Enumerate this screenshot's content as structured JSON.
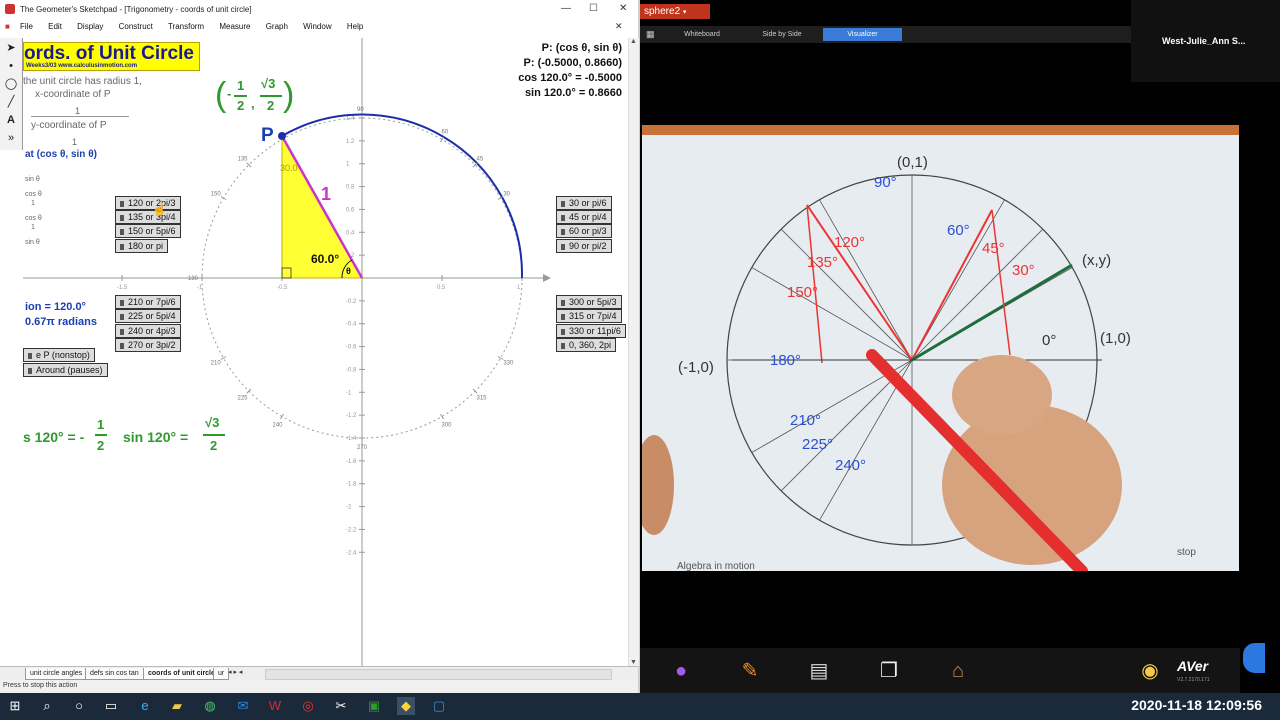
{
  "gsp": {
    "title": "The Geometer's Sketchpad - [Trigonometry - coords of unit circle]",
    "menu": [
      "File",
      "Edit",
      "Display",
      "Construct",
      "Transform",
      "Measure",
      "Graph",
      "Window",
      "Help"
    ],
    "heading": "ords. of Unit Circle",
    "subheading": "Weeks3/03  www.calculusinmotion.com",
    "notes": [
      "the unit circle has radius 1,",
      "x-coordinate of P",
      "1",
      "y-coordinate of P",
      "1"
    ],
    "at_text": "at (cos θ, sin θ)",
    "small_labels": [
      "sin θ",
      "cos θ",
      "1",
      "cos θ",
      "1",
      "sin θ"
    ],
    "rotation_line1": "ion = 120.0°",
    "rotation_line2": "0.67π radians",
    "btn_nonstop": "e P (nonstop)",
    "btn_around": "Around (pauses)",
    "left_buttons": [
      "120 or 2pi/3",
      "135 or 3pi/4",
      "150 or 5pi/6",
      "180 or pi"
    ],
    "left_buttons2": [
      "210 or 7pi/6",
      "225 or 5pi/4",
      "240 or 4pi/3",
      "270 or 3pi/2"
    ],
    "right_buttons": [
      "30 or pi/6",
      "45 or pi/4",
      "60 or pi/3",
      "90 or pi/2"
    ],
    "right_buttons2": [
      "300 or 5pi/3",
      "315 or 7pi/4",
      "330 or 11pi/6",
      "0, 360, 2pi"
    ],
    "info": [
      "P: (cos θ, sin θ)",
      "P: (-0.5000, 0.8660)",
      "cos 120.0° = -0.5000",
      "sin 120.0° = 0.8660"
    ],
    "point_label": "P",
    "hyp_label": "1",
    "angle_label": "60.0°",
    "theta": "θ",
    "angle30": "30.0",
    "coord_label": {
      "x_num": "1",
      "x_den": "2",
      "y_num": "√3",
      "y_den": "2",
      "neg": "-"
    },
    "bottom": {
      "cos_prefix": "s 120° = -",
      "cos_num": "1",
      "cos_den": "2",
      "sin_prefix": "sin 120° =",
      "sin_num": "√3",
      "sin_den": "2"
    },
    "axis_x_ticks": [
      "-1.5",
      "-1",
      "-0.5",
      "0.5",
      "1"
    ],
    "axis_y_ticks": [
      "1.4",
      "1.2",
      "1",
      "0.8",
      "0.6",
      "0.4",
      "0.2",
      "-0.2",
      "-0.4",
      "-0.6",
      "-0.8",
      "-1",
      "-1.2",
      "-1.4",
      "-1.6",
      "-1.8",
      "-2",
      "-2.2",
      "-2.4"
    ],
    "circle_degree_labels": [
      "90",
      "60",
      "45",
      "30",
      "135",
      "150",
      "180",
      "210",
      "225",
      "240",
      "270",
      "300",
      "315",
      "330"
    ],
    "page_tabs": [
      "unit circle angles",
      "defs sin cos tan",
      "coords of unit circle",
      "ur"
    ],
    "status": "Press to stop this action"
  },
  "viz": {
    "app_tab": "sphere2",
    "tabs": [
      "Whiteboard",
      "Side by Side",
      "Visualizer"
    ],
    "user": "West-Julie_Ann S...",
    "paper_labels": [
      "(0,1)",
      "90°",
      "(-1,0)",
      "(1,0)",
      "180°",
      "30°",
      "60°",
      "45°",
      "(x,y)",
      "120°",
      "135°",
      "150°",
      "210°",
      "225°",
      "240°",
      "0°"
    ],
    "paper_footer": "Algebra in motion",
    "paper_footer2": "stop",
    "dock_icons": [
      "sphere-icon",
      "pencil-icon",
      "clapper-icon",
      "stack-icon",
      "presenter-icon"
    ],
    "brand": "AVer",
    "brand_version": "V2.7.2170.171"
  },
  "taskbar": {
    "clock": "2020-11-18  12:09:56",
    "icons": [
      "windows-icon",
      "search-icon",
      "cortana-icon",
      "task-view-icon",
      "edge-icon",
      "files-icon",
      "chrome-icon",
      "outlook-icon",
      "ws-icon",
      "opera-icon",
      "sketchpad-icon",
      "excel-icon",
      "gsp-icon",
      "mail-icon"
    ]
  },
  "colors": {
    "blue": "#1a3fb0",
    "green": "#2e9a2e",
    "magenta": "#cc33cc",
    "yellow": "#ffff33",
    "accent_red": "#c0331c"
  }
}
